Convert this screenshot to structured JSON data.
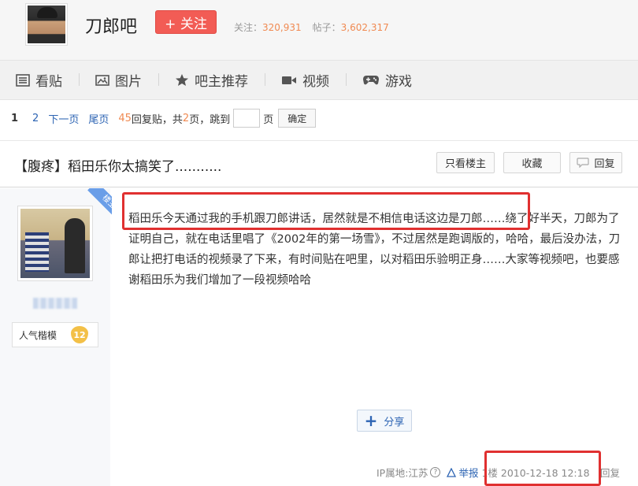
{
  "header": {
    "forum_name": "刀郎吧",
    "follow_label": "+ 关注",
    "followers_label": "关注：",
    "followers_count": "320,931",
    "posts_label": "帖子：",
    "posts_count": "3,602,317"
  },
  "nav": {
    "items": [
      {
        "label": "看贴",
        "icon": "list-icon"
      },
      {
        "label": "图片",
        "icon": "image-icon"
      },
      {
        "label": "吧主推荐",
        "icon": "star-icon"
      },
      {
        "label": "视频",
        "icon": "video-icon"
      },
      {
        "label": "游戏",
        "icon": "gamepad-icon"
      }
    ]
  },
  "pager": {
    "current": "1",
    "page2": "2",
    "next": "下一页",
    "last": "尾页",
    "reply_count": "45",
    "reply_text": "回复贴，共",
    "total_pages": "2",
    "pages_text": "页，跳到",
    "page_unit": "页",
    "confirm": "确定"
  },
  "post": {
    "title": "【腹疼】稻田乐你太搞笑了...........",
    "only_op": "只看楼主",
    "favorite": "收藏",
    "reply": "回复",
    "ribbon": "楼主",
    "level_title": "人气楷模",
    "level_num": "12",
    "body": "稻田乐今天通过我的手机跟刀郎讲话，居然就是不相信电话这边是刀郎……绕了好半天，刀郎为了证明自己，就在电话里唱了《2002年的第一场雪》，不过居然是跑调版的，哈哈，最后没办法，刀郎让把打电话的视频录了下来，有时间贴在吧里，以对稻田乐验明正身……大家等视频吧，也要感谢稻田乐为我们增加了一段视频哈哈",
    "share": "分享",
    "ip_location": "IP属地:江苏",
    "report": "举报",
    "floor_time": "1楼 2010-12-18 12:18",
    "tail": "回复"
  }
}
